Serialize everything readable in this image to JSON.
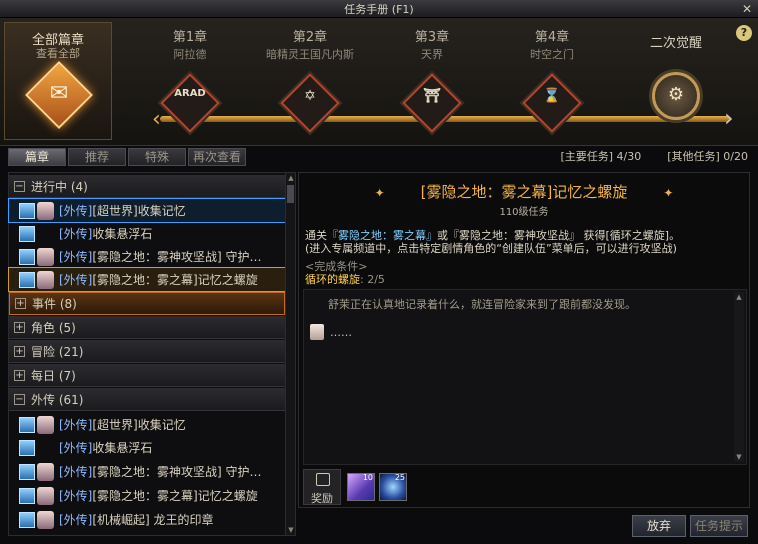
{
  "window": {
    "title": "任务手册 (F1)",
    "close_glyph": "✕"
  },
  "chapters": {
    "all": {
      "title": "全部篇章",
      "subtitle": "查看全部"
    },
    "list": [
      {
        "number": "第1章",
        "name": "阿拉德",
        "glyph": "ARAD"
      },
      {
        "number": "第2章",
        "name": "暗精灵王国凡内斯",
        "glyph": "✡"
      },
      {
        "number": "第3章",
        "name": "天界",
        "glyph": "⛩"
      },
      {
        "number": "第4章",
        "name": "时空之门",
        "glyph": "⌛"
      }
    ],
    "awakening": {
      "label": "二次觉醒",
      "glyph": "⚙"
    },
    "help": "?"
  },
  "tabs": [
    {
      "label": "篇章",
      "active": true
    },
    {
      "label": "推荐",
      "active": false
    },
    {
      "label": "特殊",
      "active": false
    },
    {
      "label": "再次查看",
      "active": false
    }
  ],
  "counters": {
    "main": "[主要任务] 4/30",
    "other": "[其他任务] 0/20"
  },
  "quest_list": {
    "in_progress": {
      "label": "进行中 (4)",
      "toggle": "−"
    },
    "in_progress_items": [
      {
        "tag": "[外传]",
        "name": "[超世界]收集记忆",
        "has_face": true
      },
      {
        "tag": "[外传]",
        "name": "收集悬浮石",
        "has_face": false
      },
      {
        "tag": "[外传]",
        "name": "[雾隐之地：雾神攻坚战] 守护…",
        "has_face": true
      },
      {
        "tag": "[外传]",
        "name": "[雾隐之地：雾之幕]记忆之螺旋",
        "has_face": true
      }
    ],
    "categories": [
      {
        "label": "事件 (8)",
        "toggle": "+"
      },
      {
        "label": "角色 (5)",
        "toggle": "+"
      },
      {
        "label": "冒险 (21)",
        "toggle": "+"
      },
      {
        "label": "每日 (7)",
        "toggle": "+"
      }
    ],
    "side": {
      "label": "外传 (61)",
      "toggle": "−"
    },
    "side_items": [
      {
        "tag": "[外传]",
        "name": "[超世界]收集记忆",
        "has_face": true
      },
      {
        "tag": "[外传]",
        "name": "收集悬浮石",
        "has_face": false
      },
      {
        "tag": "[外传]",
        "name": "[雾隐之地：雾神攻坚战] 守护…",
        "has_face": true
      },
      {
        "tag": "[外传]",
        "name": "[雾隐之地：雾之幕]记忆之螺旋",
        "has_face": true
      },
      {
        "tag": "[外传]",
        "name": "[机械崛起] 龙王的印章",
        "has_face": true
      }
    ]
  },
  "detail": {
    "title": "[雾隐之地：雾之幕]记忆之螺旋",
    "star": "✦",
    "level": "110级任务",
    "desc_prefix": "通关",
    "desc_link1": "『雾隐之地：雾之幕』",
    "desc_mid": "或『雾隐之地：雾神攻坚战』 获得[循环之螺旋]。",
    "desc_line2": "(进入专属频道中，点击特定剧情角色的“创建队伍”菜单后，可以进行攻坚战)",
    "condition": "<完成条件>",
    "progress_label": "循环的螺旋",
    "progress_value": ": 2/5",
    "dialog_line1": "舒茉正在认真地记录着什么，就连冒险家来到了跟前都没发现。",
    "dialog_line2": "……",
    "reward_label": "奖励",
    "rewards": [
      {
        "count": "10",
        "icon": "purple-crystal-icon"
      },
      {
        "count": "25",
        "icon": "blue-orb-icon"
      }
    ]
  },
  "buttons": {
    "abandon": "放弃",
    "hint": "任务提示"
  }
}
